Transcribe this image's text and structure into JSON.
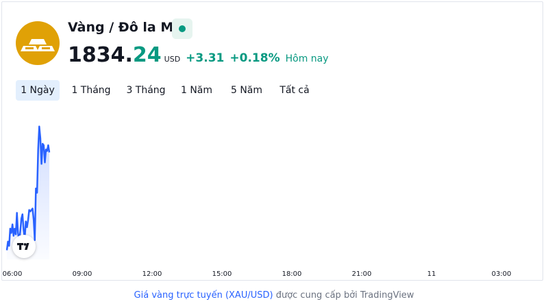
{
  "header": {
    "title": "Vàng / Đô la Mỹ",
    "price_main": "1834.",
    "price_decimal": "24",
    "currency": "USD",
    "change_abs": "+3.31",
    "change_pct": "+0.18%",
    "period_label": "Hôm nay"
  },
  "tabs": [
    {
      "label": "1 Ngày",
      "active": true
    },
    {
      "label": "1 Tháng",
      "active": false
    },
    {
      "label": "3 Tháng",
      "active": false
    },
    {
      "label": "1 Năm",
      "active": false
    },
    {
      "label": "5 Năm",
      "active": false
    },
    {
      "label": "Tất cả",
      "active": false
    }
  ],
  "colors": {
    "accent_green": "#089981",
    "line_blue": "#2962ff",
    "gold": "#e0a106",
    "tab_active_bg": "#e3effd"
  },
  "chart_data": {
    "type": "area",
    "x_tick_labels": [
      "06:00",
      "09:00",
      "12:00",
      "15:00",
      "18:00",
      "21:00",
      "11",
      "03:00"
    ],
    "series": [
      {
        "values": [
          1828.0,
          1828.6,
          1828.3,
          1829.5,
          1829.2,
          1829.8,
          1829.0,
          1829.5,
          1829.1,
          1830.6,
          1829.2,
          1828.6,
          1829.3,
          1830.2,
          1830.5,
          1829.4,
          1828.8,
          1830.0,
          1829.6,
          1830.1,
          1830.8,
          1830.7,
          1830.8,
          1830.9,
          1830.1,
          1828.7,
          1832.3,
          1832.0,
          1835.0,
          1836.6,
          1835.8,
          1834.0,
          1835.4,
          1835.3,
          1834.1,
          1835.0,
          1834.9,
          1835.3,
          1834.8
        ]
      }
    ],
    "ylim": [
      1827.5,
      1837.4
    ],
    "x_domain_hours": [
      0,
      24
    ]
  },
  "footer": {
    "link_text": "Giá vàng trực tuyến (XAU/USD)",
    "rest_text": " được cung cấp bởi TradingView"
  }
}
